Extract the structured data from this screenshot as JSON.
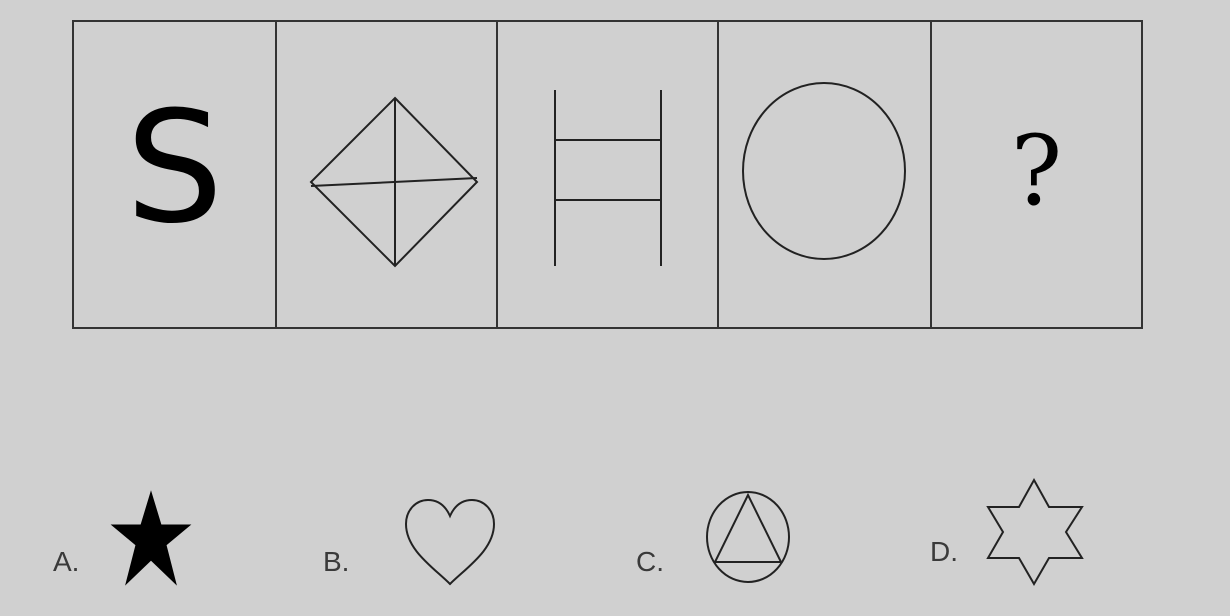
{
  "question": {
    "cells": [
      {
        "kind": "text",
        "icon": "letter-s",
        "text": "S"
      },
      {
        "kind": "shape",
        "icon": "diamond-with-crossed-diagonals-icon"
      },
      {
        "kind": "shape",
        "icon": "ladder-two-rungs-icon"
      },
      {
        "kind": "shape",
        "icon": "circle-icon"
      },
      {
        "kind": "text",
        "icon": "question-mark",
        "text": "?"
      }
    ]
  },
  "options": [
    {
      "label": "A.",
      "icon": "filled-star-icon"
    },
    {
      "label": "B.",
      "icon": "heart-outline-icon"
    },
    {
      "label": "C.",
      "icon": "triangle-in-circle-icon"
    },
    {
      "label": "D.",
      "icon": "six-point-star-outline-icon"
    }
  ]
}
